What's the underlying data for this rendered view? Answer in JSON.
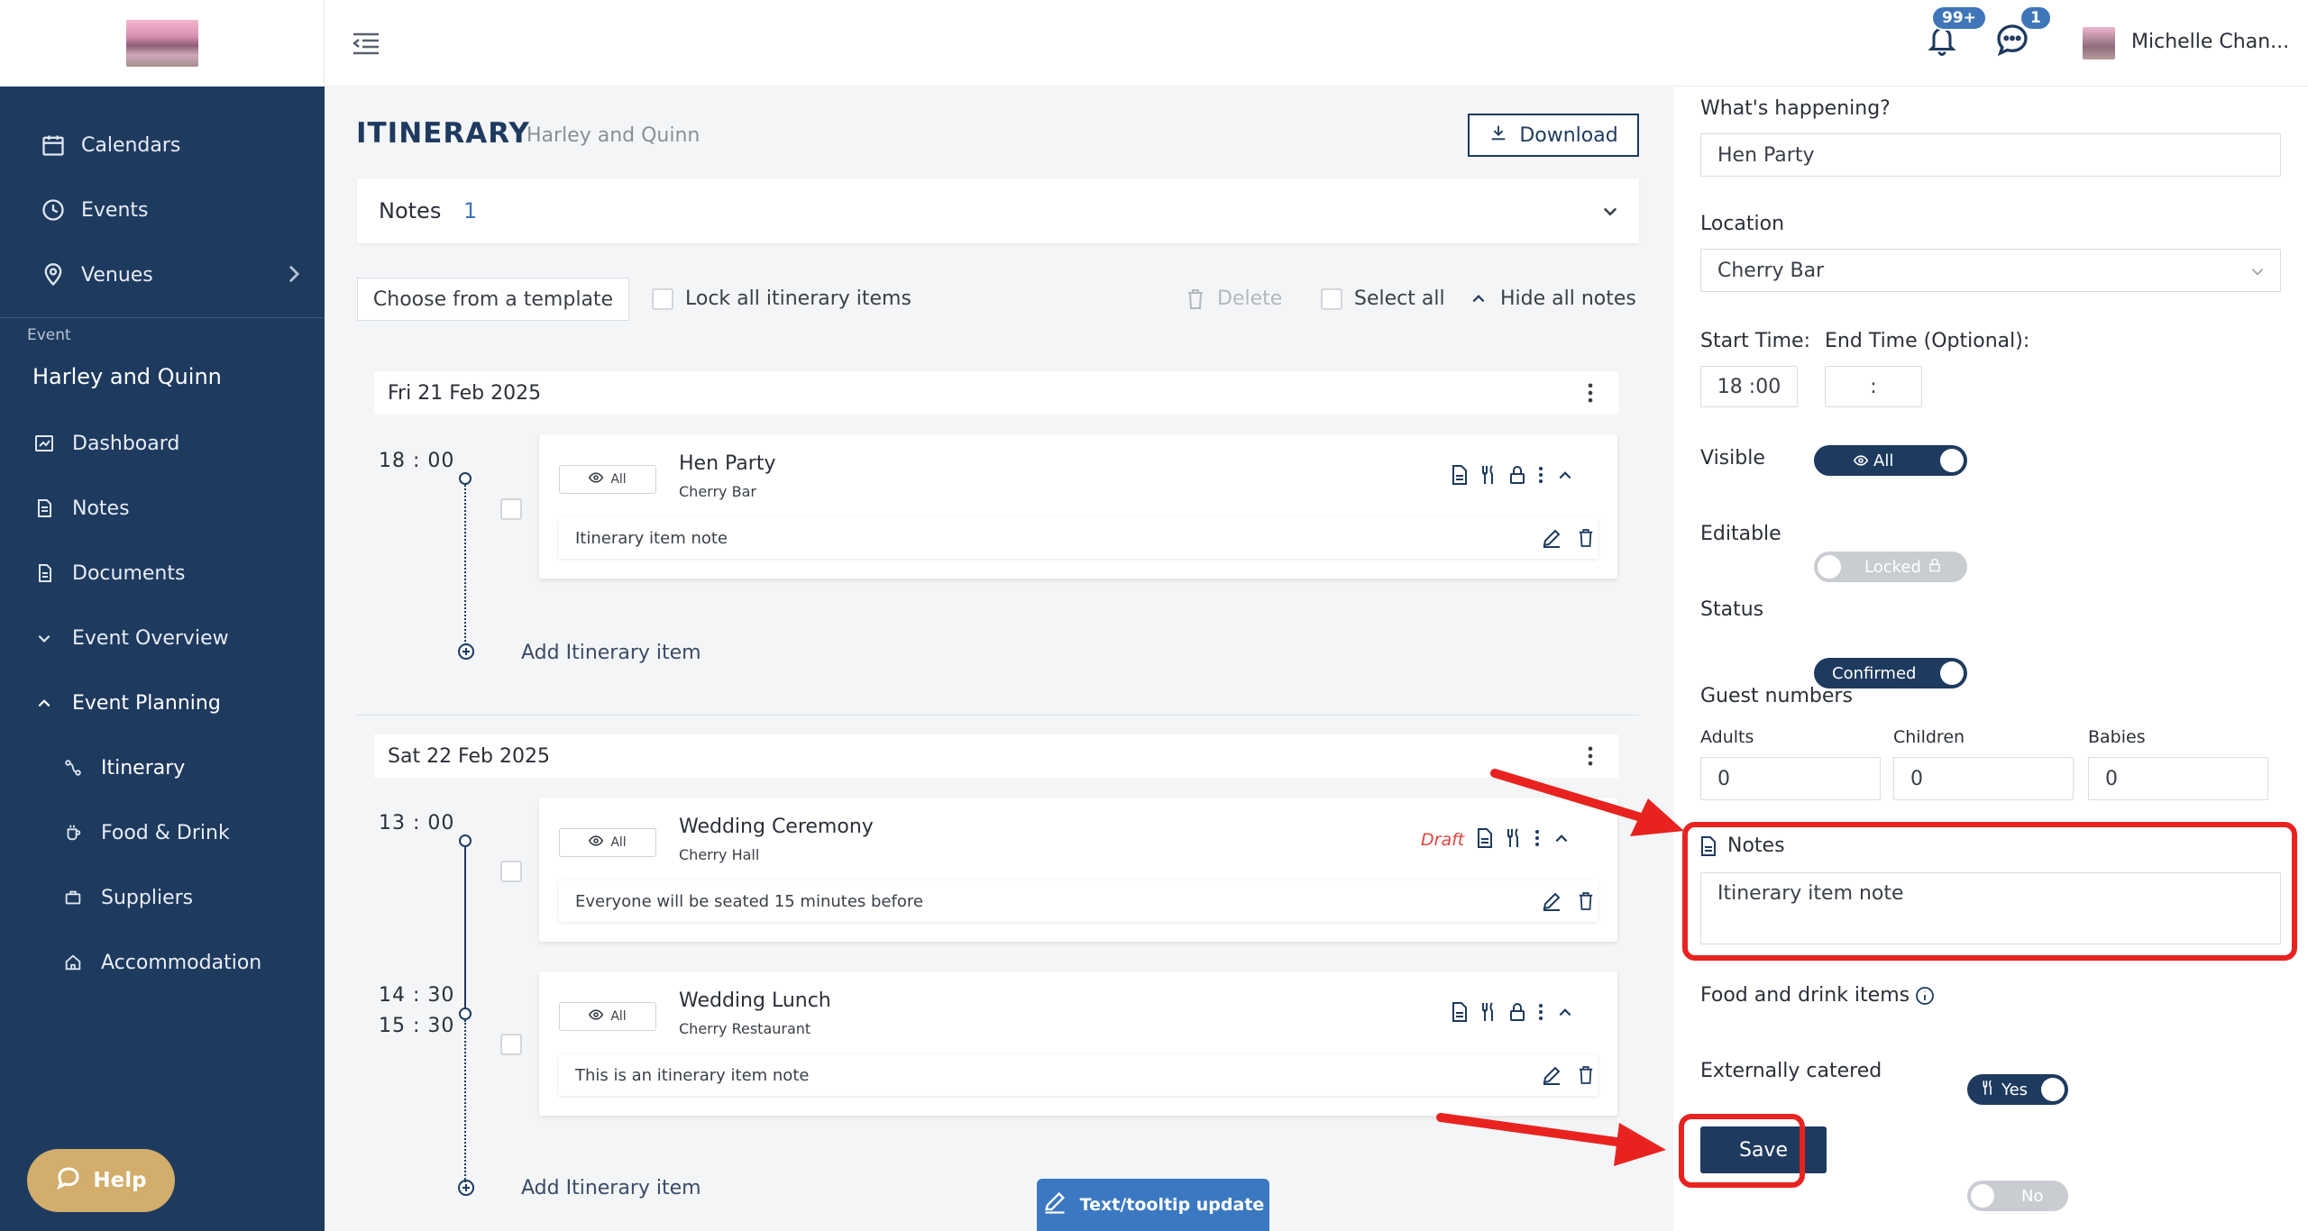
{
  "sidebar": {
    "items": [
      {
        "label": "Calendars",
        "icon": "calendar-icon"
      },
      {
        "label": "Events",
        "icon": "clock-icon"
      },
      {
        "label": "Venues",
        "icon": "location-pin-icon"
      }
    ],
    "section_label": "Event",
    "event_name": "Harley and Quinn",
    "event_items": [
      {
        "label": "Dashboard",
        "icon": "dashboard-icon"
      },
      {
        "label": "Notes",
        "icon": "document-icon"
      },
      {
        "label": "Documents",
        "icon": "files-icon"
      },
      {
        "label": "Event Overview",
        "icon": "chevron-down-icon"
      },
      {
        "label": "Event Planning",
        "icon": "chevron-up-icon"
      }
    ],
    "planning_items": [
      {
        "label": "Itinerary",
        "icon": "route-icon"
      },
      {
        "label": "Food & Drink",
        "icon": "cup-icon"
      },
      {
        "label": "Suppliers",
        "icon": "briefcase-icon"
      },
      {
        "label": "Accommodation",
        "icon": "home-icon"
      }
    ],
    "help_label": "Help"
  },
  "topbar": {
    "notifications_badge": "99+",
    "messages_badge": "1",
    "user_name": "Michelle Chan..."
  },
  "main": {
    "title": "ITINERARY",
    "subtitle": "Harley and Quinn",
    "download_label": "Download",
    "notes_label": "Notes",
    "notes_count": "1",
    "template_label": "Choose from a template",
    "lock_all_label": "Lock all itinerary items",
    "delete_label": "Delete",
    "select_all_label": "Select all",
    "hide_notes_label": "Hide all notes",
    "days": [
      {
        "date": "Fri 21 Feb 2025",
        "items": [
          {
            "time": "18 : 00",
            "visibility": "All",
            "title": "Hen Party",
            "location": "Cherry Bar",
            "note": "Itinerary item note",
            "status": ""
          }
        ],
        "add_label": "Add Itinerary item"
      },
      {
        "date": "Sat 22 Feb 2025",
        "items": [
          {
            "time": "13 : 00",
            "visibility": "All",
            "title": "Wedding Ceremony",
            "location": "Cherry Hall",
            "note": "Everyone will be seated 15 minutes before",
            "status": "Draft"
          },
          {
            "time": "14 : 30",
            "time_end": "15 : 30",
            "visibility": "All",
            "title": "Wedding Lunch",
            "location": "Cherry Restaurant",
            "note": "This is an itinerary item note",
            "status": ""
          }
        ],
        "add_label": "Add Itinerary item"
      }
    ],
    "tooltip_update_label": "Text/tooltip update"
  },
  "panel": {
    "whats_happening_label": "What's happening?",
    "whats_happening_value": "Hen Party",
    "location_label": "Location",
    "location_value": "Cherry Bar",
    "start_time_label": "Start Time:",
    "end_time_label": "End Time (Optional):",
    "start_time_value": "18 :00",
    "end_time_value": ":",
    "visible_label": "Visible",
    "visible_value": "All",
    "editable_label": "Editable",
    "editable_value": "Locked",
    "status_label": "Status",
    "status_value": "Confirmed",
    "guest_numbers_label": "Guest numbers",
    "adults_label": "Adults",
    "children_label": "Children",
    "babies_label": "Babies",
    "adults_value": "0",
    "children_value": "0",
    "babies_value": "0",
    "notes_label": "Notes",
    "notes_value": "Itinerary item note",
    "food_drink_label": "Food and drink items",
    "food_drink_value": "Yes",
    "external_catered_label": "Externally catered",
    "external_catered_value": "No",
    "save_label": "Save"
  },
  "colors": {
    "sidebar": "#1e3a5f",
    "accent": "#3f76b8",
    "highlight": "#e8231f"
  }
}
